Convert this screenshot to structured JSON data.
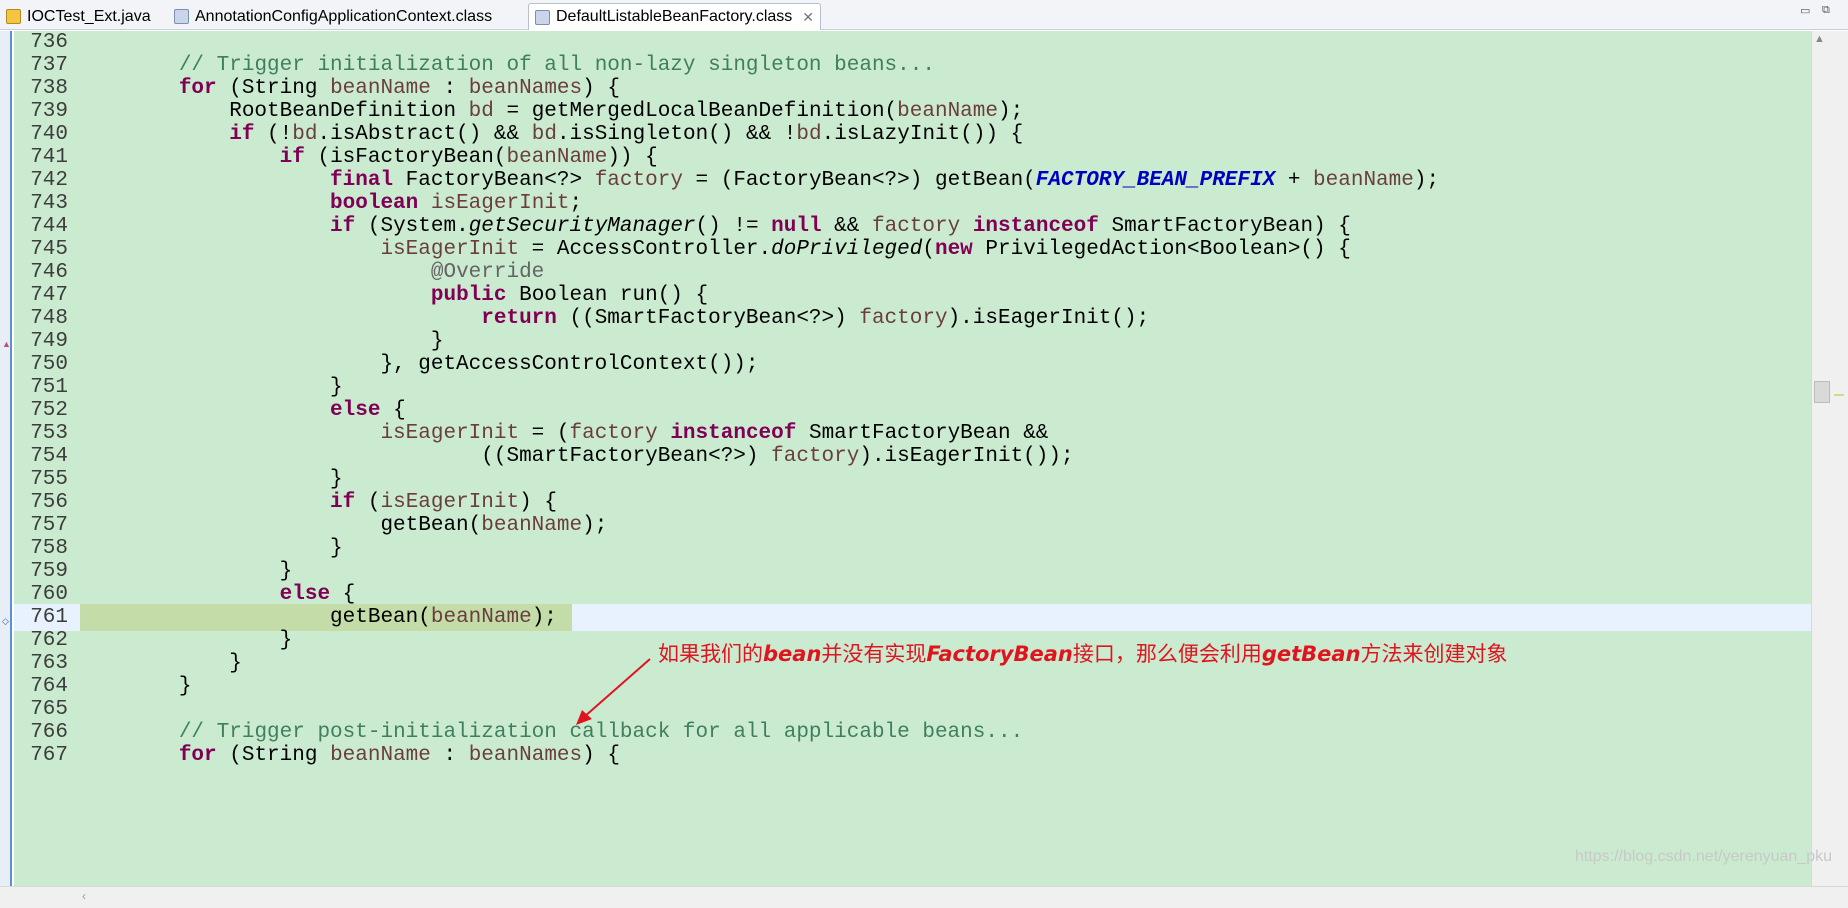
{
  "tabs": [
    {
      "label": "IOCTest_Ext.java",
      "active": false
    },
    {
      "label": "AnnotationConfigApplicationContext.class",
      "active": false
    },
    {
      "label": "DefaultListableBeanFactory.class",
      "active": true
    }
  ],
  "tab_close_glyph": "✕",
  "window_controls": [
    "▭",
    "⧉"
  ],
  "current_line": "761",
  "code_lines": [
    {
      "num": "736",
      "tokens": []
    },
    {
      "num": "737",
      "tokens": [
        {
          "t": "        "
        },
        {
          "c": "c",
          "t": "// Trigger initialization of all non-lazy singleton beans..."
        }
      ]
    },
    {
      "num": "738",
      "tokens": [
        {
          "t": "        "
        },
        {
          "c": "k",
          "t": "for"
        },
        {
          "t": " (String "
        },
        {
          "c": "v",
          "t": "beanName"
        },
        {
          "t": " : "
        },
        {
          "c": "v",
          "t": "beanNames"
        },
        {
          "t": ") {"
        }
      ]
    },
    {
      "num": "739",
      "tokens": [
        {
          "t": "            RootBeanDefinition "
        },
        {
          "c": "v",
          "t": "bd"
        },
        {
          "t": " = getMergedLocalBeanDefinition("
        },
        {
          "c": "v",
          "t": "beanName"
        },
        {
          "t": ");"
        }
      ]
    },
    {
      "num": "740",
      "tokens": [
        {
          "t": "            "
        },
        {
          "c": "k",
          "t": "if"
        },
        {
          "t": " (!"
        },
        {
          "c": "v",
          "t": "bd"
        },
        {
          "t": ".isAbstract() && "
        },
        {
          "c": "v",
          "t": "bd"
        },
        {
          "t": ".isSingleton() && !"
        },
        {
          "c": "v",
          "t": "bd"
        },
        {
          "t": ".isLazyInit()) {"
        }
      ]
    },
    {
      "num": "741",
      "tokens": [
        {
          "t": "                "
        },
        {
          "c": "k",
          "t": "if"
        },
        {
          "t": " (isFactoryBean("
        },
        {
          "c": "v",
          "t": "beanName"
        },
        {
          "t": ")) {"
        }
      ]
    },
    {
      "num": "742",
      "tokens": [
        {
          "t": "                    "
        },
        {
          "c": "k",
          "t": "final"
        },
        {
          "t": " FactoryBean<?> "
        },
        {
          "c": "v",
          "t": "factory"
        },
        {
          "t": " = (FactoryBean<?>) getBean("
        },
        {
          "c": "f",
          "t": "FACTORY_BEAN_PREFIX"
        },
        {
          "t": " + "
        },
        {
          "c": "v",
          "t": "beanName"
        },
        {
          "t": ");"
        }
      ]
    },
    {
      "num": "743",
      "tokens": [
        {
          "t": "                    "
        },
        {
          "c": "k",
          "t": "boolean"
        },
        {
          "t": " "
        },
        {
          "c": "v",
          "t": "isEagerInit"
        },
        {
          "t": ";"
        }
      ]
    },
    {
      "num": "744",
      "tokens": [
        {
          "t": "                    "
        },
        {
          "c": "k",
          "t": "if"
        },
        {
          "t": " (System."
        },
        {
          "c": "m",
          "t": "getSecurityManager"
        },
        {
          "t": "() != "
        },
        {
          "c": "k",
          "t": "null"
        },
        {
          "t": " && "
        },
        {
          "c": "v",
          "t": "factory"
        },
        {
          "t": " "
        },
        {
          "c": "k",
          "t": "instanceof"
        },
        {
          "t": " SmartFactoryBean) {"
        }
      ]
    },
    {
      "num": "745",
      "tokens": [
        {
          "t": "                        "
        },
        {
          "c": "v",
          "t": "isEagerInit"
        },
        {
          "t": " = AccessController."
        },
        {
          "c": "m",
          "t": "doPrivileged"
        },
        {
          "t": "("
        },
        {
          "c": "k",
          "t": "new"
        },
        {
          "t": " PrivilegedAction<Boolean>() {"
        }
      ]
    },
    {
      "num": "746",
      "tokens": [
        {
          "t": "                            "
        },
        {
          "c": "a",
          "t": "@Override"
        }
      ]
    },
    {
      "num": "747",
      "tokens": [
        {
          "t": "                            "
        },
        {
          "c": "k",
          "t": "public"
        },
        {
          "t": " Boolean run() {"
        }
      ]
    },
    {
      "num": "748",
      "tokens": [
        {
          "t": "                                "
        },
        {
          "c": "k",
          "t": "return"
        },
        {
          "t": " ((SmartFactoryBean<?>) "
        },
        {
          "c": "v",
          "t": "factory"
        },
        {
          "t": ").isEagerInit();"
        }
      ]
    },
    {
      "num": "749",
      "tokens": [
        {
          "t": "                            }"
        }
      ]
    },
    {
      "num": "750",
      "tokens": [
        {
          "t": "                        }, getAccessControlContext());"
        }
      ]
    },
    {
      "num": "751",
      "tokens": [
        {
          "t": "                    }"
        }
      ]
    },
    {
      "num": "752",
      "tokens": [
        {
          "t": "                    "
        },
        {
          "c": "k",
          "t": "else"
        },
        {
          "t": " {"
        }
      ]
    },
    {
      "num": "753",
      "tokens": [
        {
          "t": "                        "
        },
        {
          "c": "v",
          "t": "isEagerInit"
        },
        {
          "t": " = ("
        },
        {
          "c": "v",
          "t": "factory"
        },
        {
          "t": " "
        },
        {
          "c": "k",
          "t": "instanceof"
        },
        {
          "t": " SmartFactoryBean &&"
        }
      ]
    },
    {
      "num": "754",
      "tokens": [
        {
          "t": "                                ((SmartFactoryBean<?>) "
        },
        {
          "c": "v",
          "t": "factory"
        },
        {
          "t": ").isEagerInit());"
        }
      ]
    },
    {
      "num": "755",
      "tokens": [
        {
          "t": "                    }"
        }
      ]
    },
    {
      "num": "756",
      "tokens": [
        {
          "t": "                    "
        },
        {
          "c": "k",
          "t": "if"
        },
        {
          "t": " ("
        },
        {
          "c": "v",
          "t": "isEagerInit"
        },
        {
          "t": ") {"
        }
      ]
    },
    {
      "num": "757",
      "tokens": [
        {
          "t": "                        getBean("
        },
        {
          "c": "v",
          "t": "beanName"
        },
        {
          "t": ");"
        }
      ]
    },
    {
      "num": "758",
      "tokens": [
        {
          "t": "                    }"
        }
      ]
    },
    {
      "num": "759",
      "tokens": [
        {
          "t": "                }"
        }
      ]
    },
    {
      "num": "760",
      "tokens": [
        {
          "t": "                "
        },
        {
          "c": "k",
          "t": "else"
        },
        {
          "t": " {"
        }
      ]
    },
    {
      "num": "761",
      "tokens": [
        {
          "t": "                    getBean("
        },
        {
          "c": "v",
          "t": "beanName"
        },
        {
          "t": ");"
        }
      ]
    },
    {
      "num": "762",
      "tokens": [
        {
          "t": "                }"
        }
      ]
    },
    {
      "num": "763",
      "tokens": [
        {
          "t": "            }"
        }
      ]
    },
    {
      "num": "764",
      "tokens": [
        {
          "t": "        }"
        }
      ]
    },
    {
      "num": "765",
      "tokens": []
    },
    {
      "num": "766",
      "tokens": [
        {
          "t": "        "
        },
        {
          "c": "c",
          "t": "// Trigger post-initialization callback for all applicable beans..."
        }
      ]
    },
    {
      "num": "767",
      "tokens": [
        {
          "t": "        "
        },
        {
          "c": "k",
          "t": "for"
        },
        {
          "t": " (String "
        },
        {
          "c": "v",
          "t": "beanName"
        },
        {
          "t": " : "
        },
        {
          "c": "v",
          "t": "beanNames"
        },
        {
          "t": ") {"
        }
      ]
    }
  ],
  "annotation": {
    "parts": [
      {
        "t": "如果我们的",
        "em": false
      },
      {
        "t": "bean",
        "em": true
      },
      {
        "t": "并没有实现",
        "em": false
      },
      {
        "t": "FactoryBean",
        "em": true
      },
      {
        "t": "接口，那么便会利用",
        "em": false
      },
      {
        "t": "getBean",
        "em": true
      },
      {
        "t": "方法来创建对象",
        "em": false
      }
    ]
  },
  "watermark": "https://blog.csdn.net/yerenyuan_pku",
  "colors": {
    "editor_bg": "#cbebd0",
    "current_line_bg": "#e8f2fe",
    "keyword": "#7f0055",
    "comment": "#3f7f5f",
    "variable": "#6a3e3e",
    "constant": "#0000c0",
    "annotation_text": "#e0141e"
  }
}
